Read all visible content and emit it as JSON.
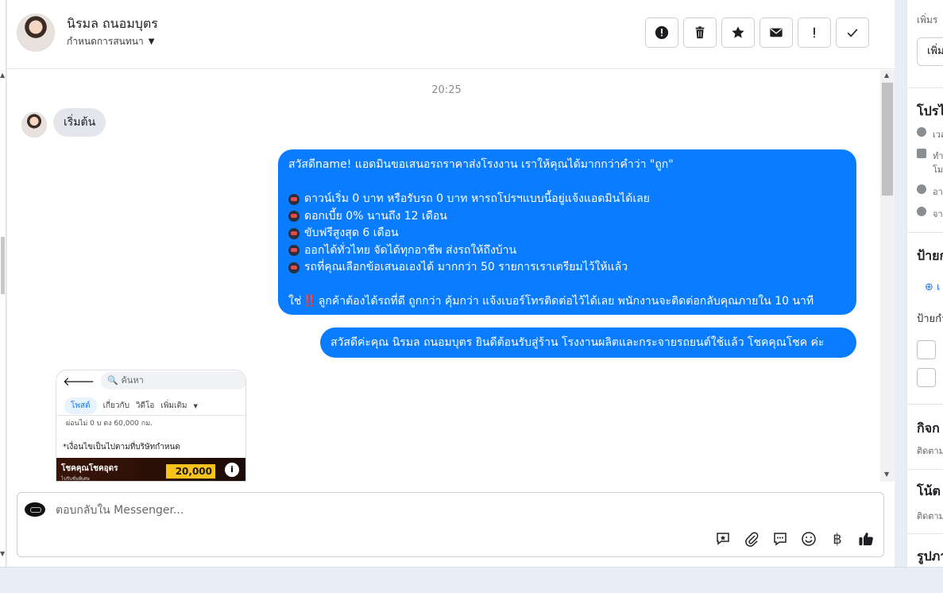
{
  "header": {
    "contact_name": "นิรมล ถนอมบุตร",
    "assign_label": "กำหนดการสนทนา"
  },
  "actions": [
    {
      "name": "spam-button",
      "icon": "alert-circle-icon"
    },
    {
      "name": "delete-button",
      "icon": "trash-icon"
    },
    {
      "name": "star-button",
      "icon": "star-icon"
    },
    {
      "name": "mark-unread-button",
      "icon": "envelope-icon"
    },
    {
      "name": "follow-up-button",
      "icon": "exclamation-icon"
    },
    {
      "name": "done-button",
      "icon": "check-icon"
    }
  ],
  "messages": {
    "timestamp": "20:25",
    "start_text": "เริ่มต้น",
    "greeting_line": "สวัสดีname! แอดมินขอเสนอรถราคาส่งโรงงาน เราให้คุณได้มากกว่าคำว่า \"ถูก\"",
    "bullets": [
      "ดาวน์เริ่ม 0 บาท หรือรับรถ 0 บาท หารถโปรฯแบบนี้อยู่แจ้งแอดมินได้เลย",
      "ดอกเบี้ย 0% นานถึง 12 เดือน",
      "ขับฟรีสูงสุด 6 เดือน",
      "ออกได้ทั่วไทย จัดได้ทุกอาชีพ ส่งรถให้ถึงบ้าน",
      "รถที่คุณเลือกข้อเสนอเองได้ มากกว่า 50 รายการเราเตรียมไว้ให้แล้ว"
    ],
    "closing_prefix": "ใช่",
    "closing_mark": "‼️",
    "closing_text": "ลูกค้าต้องได้รถที่ดี ถูกกว่า คุ้มกว่า แจ้งเบอร์โทรติดต่อไว้ได้เลย พนักงานจะติดต่อกลับคุณภายใน 10 นาที",
    "second_message": "สวัสดีค่ะคุณ นิรมล ถนอมบุตร ยินดีต้อนรับสู่ร้าน โรงงานผลิตและกระจายรถยนต์ใช้แล้ว โชคคุณโชค ค่ะ"
  },
  "screenshot_attachment": {
    "search_placeholder": "ค้นหา",
    "tabs": [
      "โพสต์",
      "เกี่ยวกับ",
      "วิดีโอ",
      "เพิ่มเติม"
    ],
    "cut_text": "ผ่อนไม่ 0 บ ตง 60,000 กม.",
    "condition_text": "*เงื่อนไขเป็นไปตามที่บริษัทกำหนด",
    "banner_title": "โชคคุณโชคอุดร",
    "banner_sub": "ไปรับชั่นพิเศษ",
    "banner_price": "20,000"
  },
  "composer": {
    "placeholder": "ตอบกลับใน Messenger...",
    "tools": [
      "saved-reply-icon",
      "attachment-icon",
      "message-icon",
      "emoji-icon",
      "baht-icon",
      "thumbs-up-icon"
    ],
    "baht_glyph": "฿"
  },
  "right_panel": {
    "add_label": "เพิ่มร",
    "add_button": "เพิ่ม",
    "profile_heading": "โปรไ",
    "row_local_time": "เวล",
    "row_work_1": "ทำ",
    "row_work_2": "โม",
    "row_lives": "อา",
    "row_from": "จา",
    "labels_heading": "ป้ายก",
    "labels_add": "เ",
    "labels_sub": "ป้ายกำ",
    "activity_heading": "กิจก",
    "activity_sub": "ติดตาม",
    "notes_heading": "โน้ต",
    "notes_sub": "ติดตาม",
    "photos_heading": "รูปภา"
  }
}
